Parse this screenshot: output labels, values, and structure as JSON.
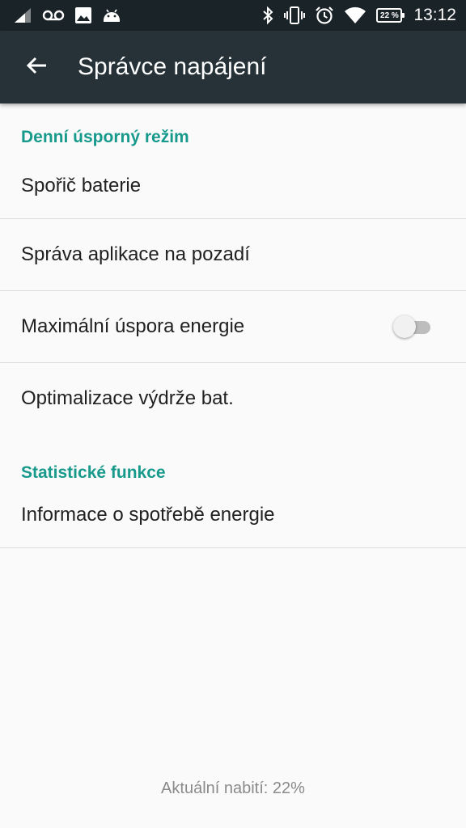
{
  "status_bar": {
    "time": "13:12",
    "battery_percent": "22 %",
    "icons": [
      "signal-icon",
      "voicemail-icon",
      "image-icon",
      "android-icon",
      "bluetooth-icon",
      "vibrate-icon",
      "alarm-icon",
      "wifi-icon",
      "battery-icon"
    ]
  },
  "app_bar": {
    "back_icon": "arrow-back-icon",
    "title": "Správce napájení"
  },
  "sections": [
    {
      "header": "Denní úsporný režim",
      "items": [
        {
          "label": "Spořič baterie"
        },
        {
          "label": "Správa aplikace na pozadí"
        },
        {
          "label": "Maximální úspora energie",
          "toggle": false
        },
        {
          "label": "Optimalizace výdrže bat."
        }
      ]
    },
    {
      "header": "Statistické funkce",
      "items": [
        {
          "label": "Informace o spotřebě energie"
        }
      ]
    }
  ],
  "footer": {
    "current_charge": "Aktuální nabití: 22%"
  },
  "colors": {
    "status_bar": "#1a2328",
    "app_bar": "#263238",
    "accent": "#179a8c",
    "background": "#fafafa"
  }
}
